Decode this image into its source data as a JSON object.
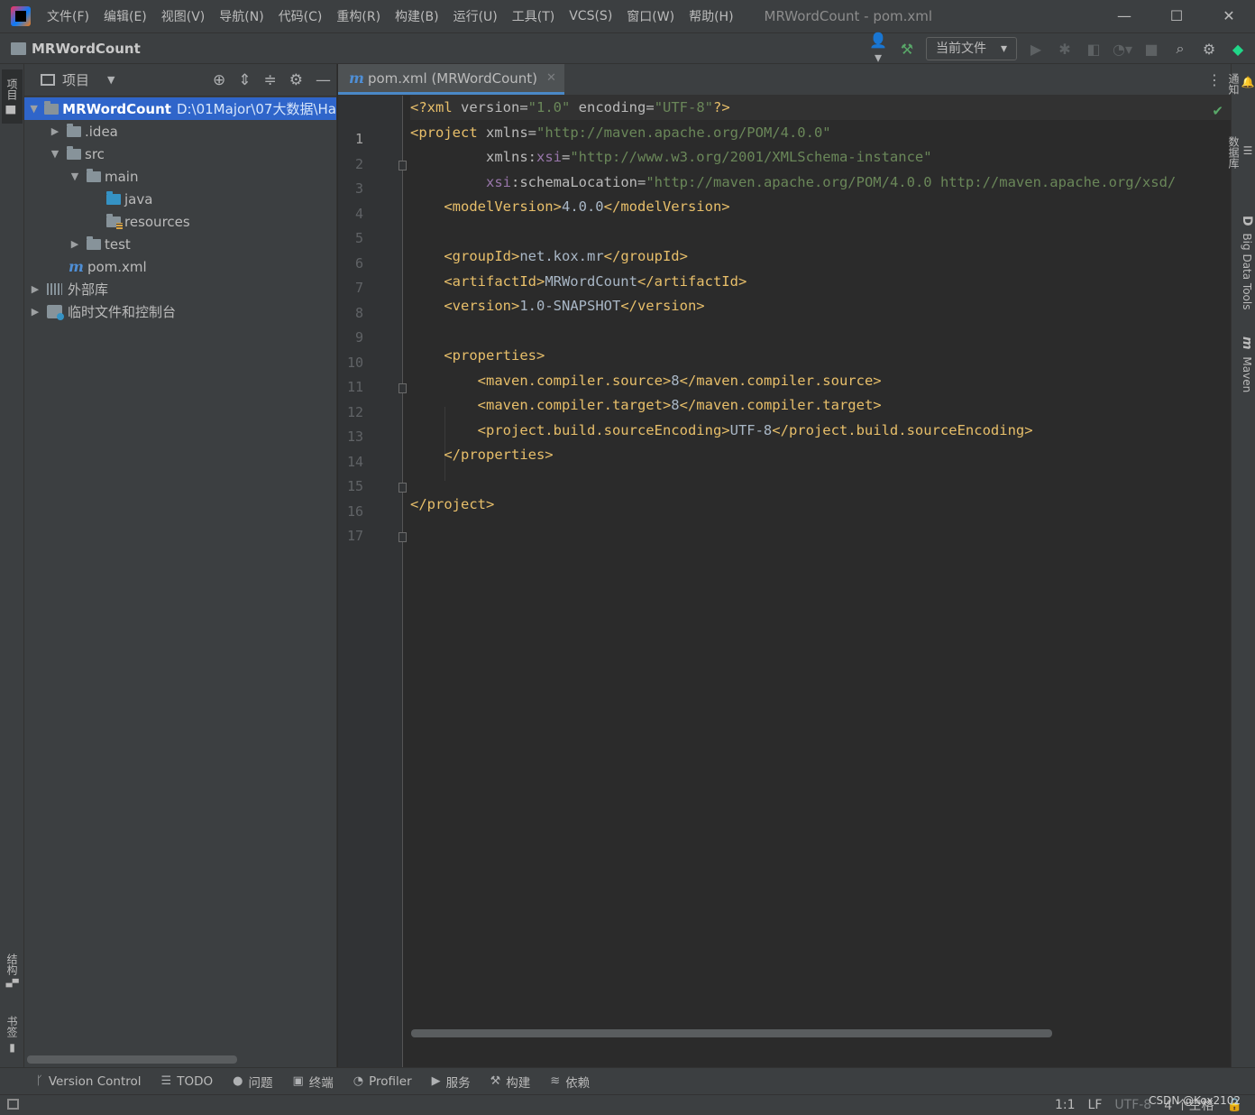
{
  "window": {
    "menu": [
      "文件(F)",
      "编辑(E)",
      "视图(V)",
      "导航(N)",
      "代码(C)",
      "重构(R)",
      "构建(B)",
      "运行(U)",
      "工具(T)",
      "VCS(S)",
      "窗口(W)",
      "帮助(H)"
    ],
    "title": "MRWordCount - pom.xml",
    "controls": {
      "minimize": "—",
      "maximize": "☐",
      "close": "✕"
    }
  },
  "toolbar": {
    "project_name": "MRWordCount",
    "run_config": "当前文件"
  },
  "left_stripe": {
    "project": "项目",
    "structure": "结构",
    "bookmarks": "书签"
  },
  "right_stripe": {
    "notifications": "通知",
    "database": "数据库",
    "big_data_tools": "Big Data Tools",
    "big_data_tools_icon": "D",
    "maven": "Maven",
    "maven_icon": "m"
  },
  "project_panel": {
    "title": "项目",
    "tree": {
      "root_name": "MRWordCount",
      "root_path": "D:\\01Major\\07大数据\\Ha",
      "idea": ".idea",
      "src": "src",
      "main": "main",
      "java": "java",
      "resources": "resources",
      "test": "test",
      "pom": "pom.xml",
      "external_libs": "外部库",
      "scratches": "临时文件和控制台"
    },
    "maven_icon": "m"
  },
  "editor": {
    "tab_label": "pom.xml (MRWordCount)",
    "tab_icon": "m",
    "line_numbers": [
      "1",
      "2",
      "3",
      "4",
      "5",
      "6",
      "7",
      "8",
      "9",
      "10",
      "11",
      "12",
      "13",
      "14",
      "15",
      "16",
      "17"
    ],
    "code": {
      "l1": {
        "a": "<?xml ",
        "b": "version",
        "c": "=",
        "d": "\"1.0\"",
        "e": " encoding",
        "f": "=",
        "g": "\"UTF-8\"",
        "h": "?>"
      },
      "l2": {
        "a": "<project ",
        "b": "xmlns",
        "c": "=",
        "d": "\"http://maven.apache.org/POM/4.0.0\""
      },
      "l3": {
        "a": "         xmlns:",
        "b": "xsi",
        "c": "=",
        "d": "\"http://www.w3.org/2001/XMLSchema-instance\""
      },
      "l4": {
        "a": "         ",
        "b": "xsi",
        "c": ":schemaLocation",
        "d": "=",
        "e": "\"http://maven.apache.org/POM/4.0.0 http://maven.apache.org/xsd/"
      },
      "l5": {
        "a": "    <modelVersion>",
        "b": "4.0.0",
        "c": "</modelVersion>"
      },
      "l7": {
        "a": "    <groupId>",
        "b": "net.kox.mr",
        "c": "</groupId>"
      },
      "l8": {
        "a": "    <artifactId>",
        "b": "MRWordCount",
        "c": "</artifactId>"
      },
      "l9": {
        "a": "    <version>",
        "b": "1.0-SNAPSHOT",
        "c": "</version>"
      },
      "l11": {
        "a": "    <properties>"
      },
      "l12": {
        "a": "        <maven.compiler.source>",
        "b": "8",
        "c": "</maven.compiler.source>"
      },
      "l13": {
        "a": "        <maven.compiler.target>",
        "b": "8",
        "c": "</maven.compiler.target>"
      },
      "l14": {
        "a": "        <project.build.sourceEncoding>",
        "b": "UTF-8",
        "c": "</project.build.sourceEncoding>"
      },
      "l15": {
        "a": "    </properties>"
      },
      "l17": {
        "a": "</project>"
      }
    }
  },
  "bottom_tools": {
    "version_control": "Version Control",
    "todo": "TODO",
    "problems": "问题",
    "terminal": "终端",
    "profiler": "Profiler",
    "services": "服务",
    "build": "构建",
    "dependencies": "依赖"
  },
  "status": {
    "position": "1:1",
    "line_sep": "LF",
    "encoding": "UTF-8",
    "indent": "4 个空格",
    "watermark": "CSDN @Kox2102"
  }
}
